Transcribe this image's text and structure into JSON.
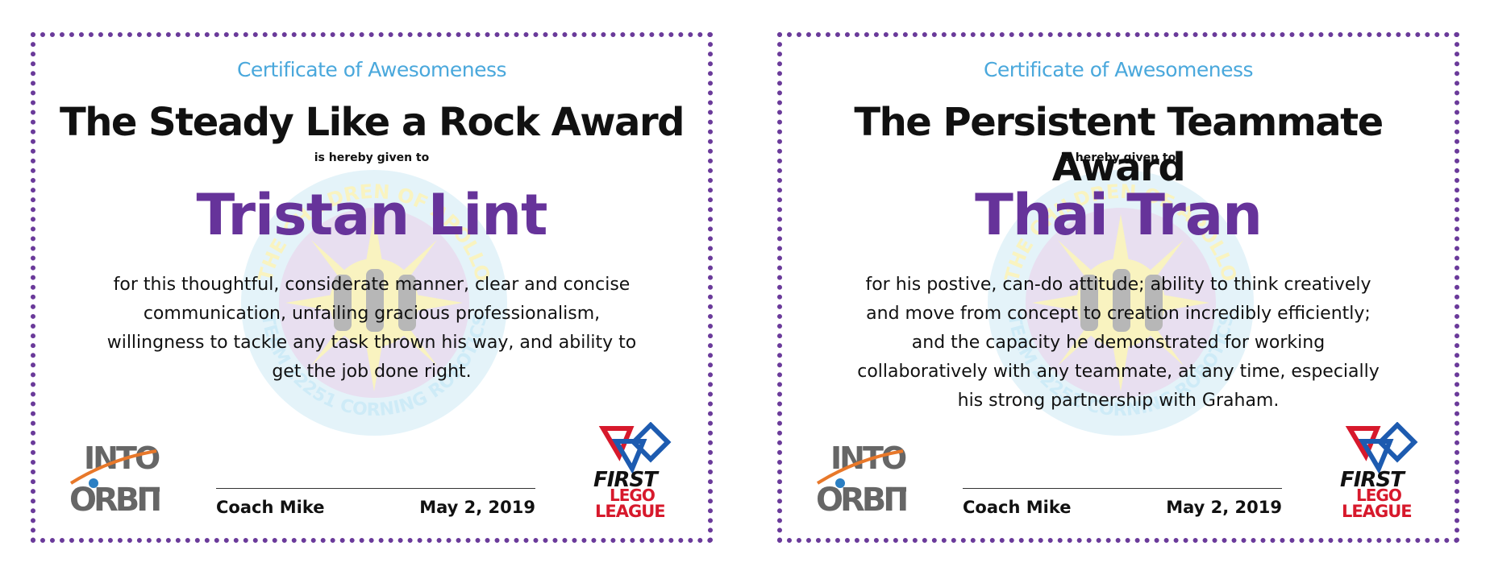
{
  "certificates": [
    {
      "subtitle": "Certificate of Awesomeness",
      "award_title": "The Steady Like a Rock Award",
      "given_to": "is hereby given to",
      "recipient": "Tristan Lint",
      "reason": "for this thoughtful, considerate manner, clear and concise communication, unfailing gracious professionalism, willingness to tackle any task thrown his way, and ability to get the job done right.",
      "signer": "Coach Mike",
      "date": "May 2, 2019"
    },
    {
      "subtitle": "Certificate of Awesomeness",
      "award_title": "The Persistent Teammate Award",
      "given_to": "is hereby given to",
      "recipient": "Thai Tran",
      "reason": "for his postive, can-do attitude; ability to think creatively and move from concept to creation incredibly efficiently; and the capacity he demonstrated for working collaboratively with any teammate, at any time, especially his strong partnership with Graham.",
      "signer": "Coach Mike",
      "date": "May 2, 2019"
    }
  ],
  "seal": {
    "text_top": "THE CHILDREN OF APOLLO",
    "text_bottom": "TEAM 22251 CORNING ROBOTICS",
    "icon": "sun-seal-icon"
  },
  "logos": {
    "orbit_line1": "INTO",
    "orbit_line2": "ORBIT",
    "fll_line1": "FIRST",
    "fll_line2": "LEGO",
    "fll_line3": "LEAGUE"
  },
  "colors": {
    "border": "#6a3a9a",
    "subtitle": "#4aa8dc",
    "recipient": "#66339a",
    "fll_red": "#d7192c",
    "fll_blue": "#1d5bb0"
  }
}
